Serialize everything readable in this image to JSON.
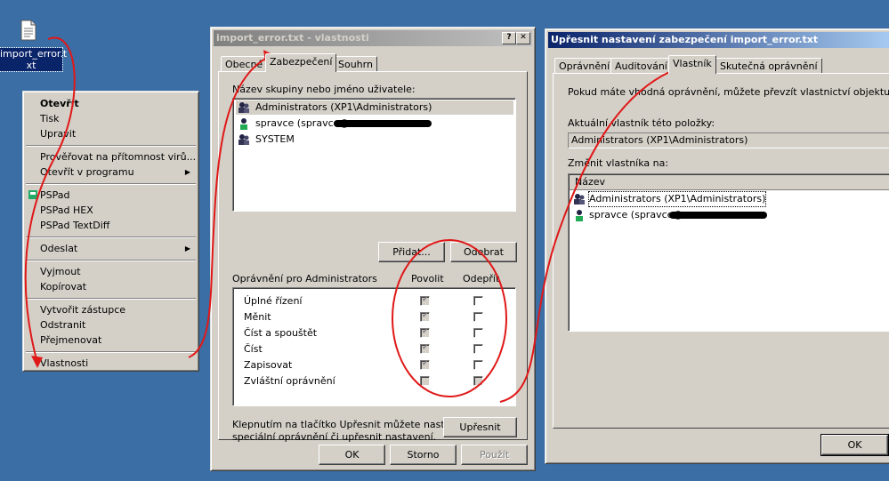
{
  "desktop": {
    "file_icon_label_1": "import_error.t",
    "file_icon_label_2": "xt"
  },
  "context_menu": {
    "items": [
      {
        "label": "Otevřít",
        "bold": true
      },
      {
        "label": "Tisk"
      },
      {
        "label": "Upravit"
      },
      {
        "label": "Prověřovat na přítomnost virů..."
      },
      {
        "label": "Otevřít v programu",
        "submenu": true
      },
      {
        "label": "PSPad"
      },
      {
        "label": "PSPad HEX"
      },
      {
        "label": "PSPad TextDiff"
      },
      {
        "label": "Odeslat",
        "submenu": true
      },
      {
        "label": "Vyjmout"
      },
      {
        "label": "Kopírovat"
      },
      {
        "label": "Vytvořit zástupce"
      },
      {
        "label": "Odstranit"
      },
      {
        "label": "Přejmenovat"
      },
      {
        "label": "Vlastnosti"
      }
    ]
  },
  "props_window": {
    "title": "import_error.txt - vlastnosti",
    "help_btn": "?",
    "close_btn": "✕",
    "tabs": [
      "Obecné",
      "Zabezpečení",
      "Souhrn"
    ],
    "group_label": "Název skupiny nebo jméno uživatele:",
    "users": [
      "Administrators (XP1\\Administrators)",
      "spravce (spravce@",
      "SYSTEM"
    ],
    "add_btn": "Přidat...",
    "remove_btn": "Odebrat",
    "perm_label": "Oprávnění pro Administrators",
    "allow_col": "Povolit",
    "deny_col": "Odepřít",
    "permissions": [
      {
        "name": "Úplné řízení",
        "allow": true,
        "deny": false
      },
      {
        "name": "Měnit",
        "allow": true,
        "deny": false
      },
      {
        "name": "Číst a spouštět",
        "allow": true,
        "deny": false
      },
      {
        "name": "Číst",
        "allow": true,
        "deny": false
      },
      {
        "name": "Zapisovat",
        "allow": true,
        "deny": false
      },
      {
        "name": "Zvláštní oprávnění",
        "allow": false,
        "deny": false
      }
    ],
    "advanced_text_1": "Klepnutím na tlačítko Upřesnit můžete nastavit",
    "advanced_text_2": "speciální oprávnění či upřesnit nastavení.",
    "advanced_btn": "Upřesnit",
    "ok_btn": "OK",
    "cancel_btn": "Storno",
    "apply_btn": "Použít"
  },
  "adv_window": {
    "title": "Upřesnit nastavení zabezpečení import_error.txt",
    "tabs": [
      "Oprávnění",
      "Auditování",
      "Vlastník",
      "Skutečná oprávnění"
    ],
    "info": "Pokud máte vhodná oprávnění, můžete převzít vlastnictví objektu.",
    "current_owner_label": "Aktuální vlastník této položky:",
    "current_owner": "Administrators (XP1\\Administrators)",
    "change_owner_label": "Změnit vlastníka na:",
    "col_name": "Název",
    "owners": [
      "Administrators (XP1\\Administrators)",
      "spravce (spravce@"
    ],
    "ok_btn": "OK"
  },
  "colors": {
    "desktop": "#3a6ea5",
    "face": "#d4d0c8",
    "annotation": "#e01818"
  }
}
